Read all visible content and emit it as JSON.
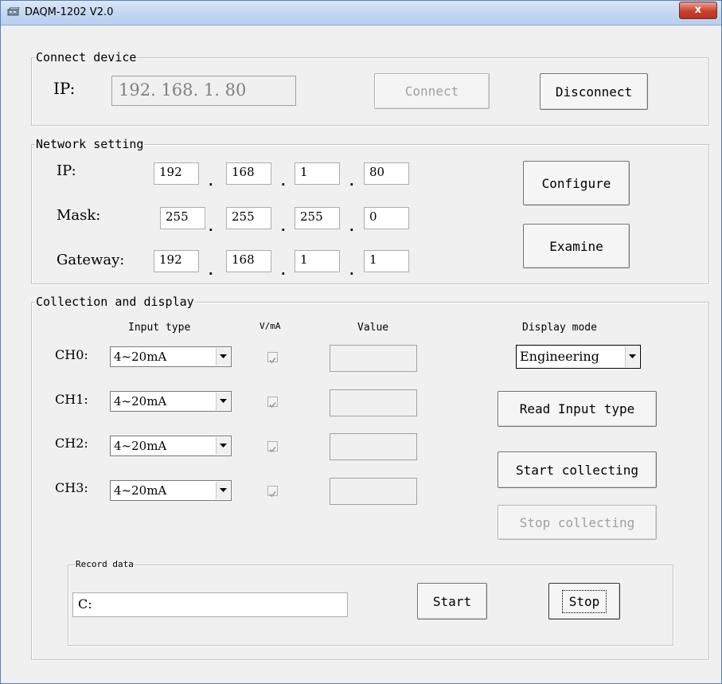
{
  "window": {
    "title": "DAQM-1202 V2.0",
    "close_glyph": "x"
  },
  "connect": {
    "legend": "Connect device",
    "ip_label": "IP:",
    "ip_value": "192. 168. 1. 80",
    "connect_label": "Connect",
    "disconnect_label": "Disconnect"
  },
  "network": {
    "legend": "Network setting",
    "dot": ".",
    "rows": [
      {
        "label": "IP:",
        "octets": [
          "192",
          "168",
          "1",
          "80"
        ]
      },
      {
        "label": "Mask:",
        "octets": [
          "255",
          "255",
          "255",
          "0"
        ]
      },
      {
        "label": "Gateway:",
        "octets": [
          "192",
          "168",
          "1",
          "1"
        ]
      }
    ],
    "configure_label": "Configure",
    "examine_label": "Examine"
  },
  "collection": {
    "legend": "Collection and display",
    "headers": {
      "input_type": "Input type",
      "vma": "V/mA",
      "value": "Value",
      "display_mode": "Display mode"
    },
    "channels": [
      {
        "label": "CH0:",
        "type": "4~20mA",
        "vma_checked": true,
        "value": ""
      },
      {
        "label": "CH1:",
        "type": "4~20mA",
        "vma_checked": true,
        "value": ""
      },
      {
        "label": "CH2:",
        "type": "4~20mA",
        "vma_checked": true,
        "value": ""
      },
      {
        "label": "CH3:",
        "type": "4~20mA",
        "vma_checked": true,
        "value": ""
      }
    ],
    "display_mode": "Engineering",
    "read_input_type_label": "Read Input type",
    "start_collecting_label": "Start collecting",
    "stop_collecting_label": "Stop collecting"
  },
  "record": {
    "legend": "Record data",
    "path": "C:",
    "start_label": "Start",
    "stop_label": "Stop"
  },
  "icons": {
    "app": "network-adapter-icon",
    "dropdown": "triangle-down-icon",
    "check": "checkmark-icon"
  }
}
